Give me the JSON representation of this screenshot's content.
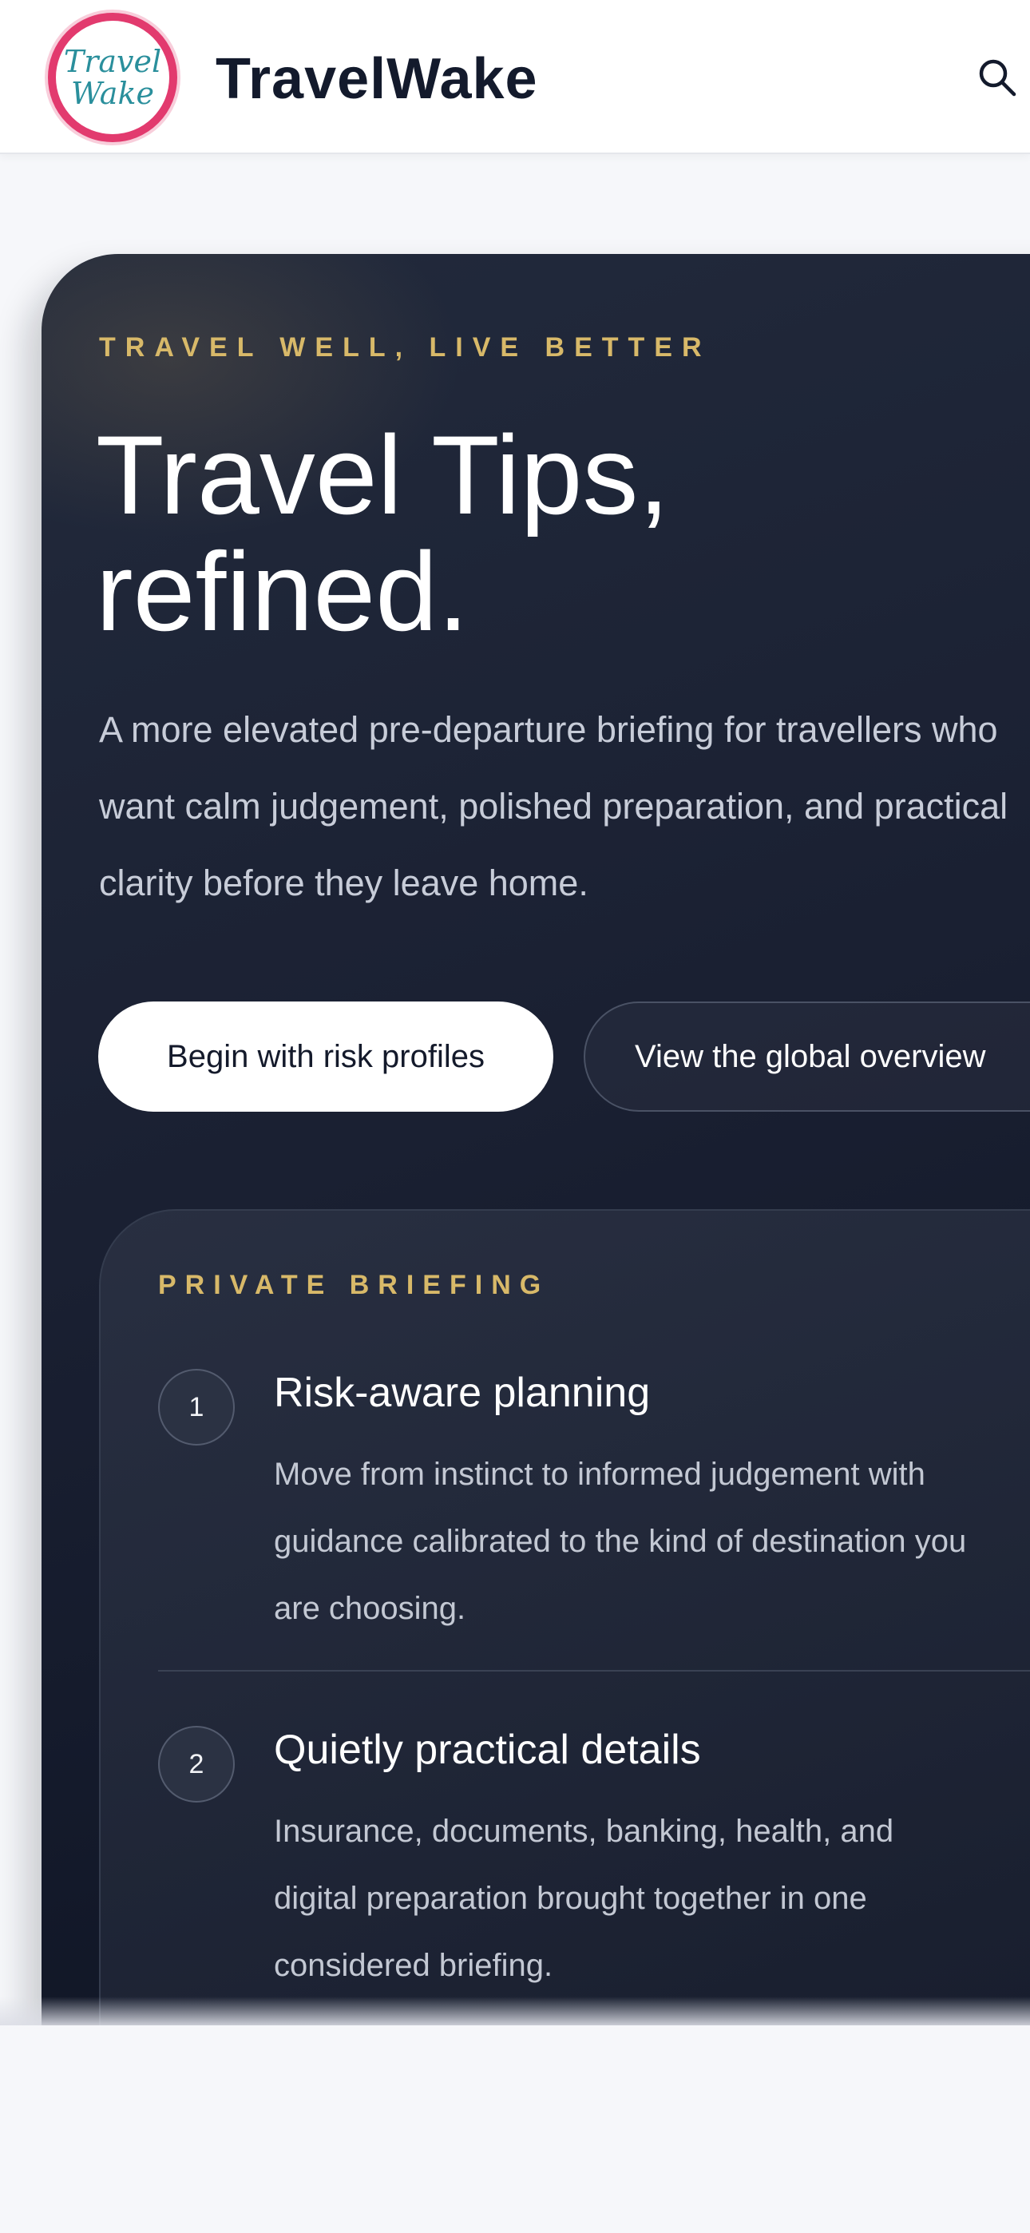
{
  "header": {
    "logo_line1": "Travel",
    "logo_line2": "Wake",
    "brand": "TravelWake"
  },
  "hero": {
    "eyebrow": "TRAVEL WELL, LIVE BETTER",
    "headline_line1": "Travel Tips,",
    "headline_line2": "refined.",
    "lede_lines": [
      "A more elevated pre-departure briefing for travellers who",
      "want calm judgement, polished preparation, and practical",
      "clarity before they leave home."
    ],
    "primary_cta": "Begin with risk profiles",
    "secondary_cta": "View the global overview"
  },
  "briefing": {
    "eyebrow": "PRIVATE BRIEFING",
    "items": [
      {
        "number": "1",
        "title": "Risk-aware planning",
        "body_lines": [
          "Move from instinct to informed judgement with",
          "guidance calibrated to the kind of destination you",
          "are choosing."
        ]
      },
      {
        "number": "2",
        "title": "Quietly practical details",
        "body_lines": [
          "Insurance, documents, banking, health, and",
          "digital preparation brought together in one",
          "considered briefing."
        ]
      }
    ]
  },
  "colors": {
    "accent_gold": "#d8b969",
    "navy": "#1a2032",
    "logo_pink": "#e23a6e",
    "logo_teal": "#2a8f9c"
  }
}
